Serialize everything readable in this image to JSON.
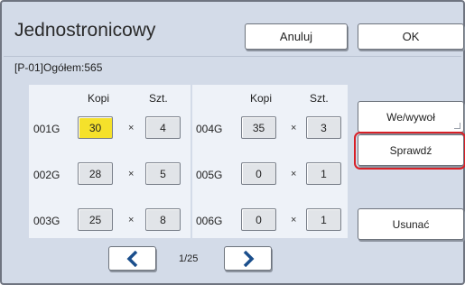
{
  "title": "Jednostronicowy",
  "buttons": {
    "cancel": "Anuluj",
    "ok": "OK",
    "import_export": "We/wywoł",
    "check": "Sprawdź",
    "delete": "Usunać"
  },
  "total_label": "[P-01]Ogółem:565",
  "headers": {
    "copies": "Kopi",
    "sets": "Szt."
  },
  "times_symbol": "×",
  "rows": [
    {
      "code": "001G",
      "copies": "30",
      "sets": "4",
      "selected": true
    },
    {
      "code": "002G",
      "copies": "28",
      "sets": "5"
    },
    {
      "code": "003G",
      "copies": "25",
      "sets": "8"
    },
    {
      "code": "004G",
      "copies": "35",
      "sets": "3"
    },
    {
      "code": "005G",
      "copies": "0",
      "sets": "1"
    },
    {
      "code": "006G",
      "copies": "0",
      "sets": "1"
    }
  ],
  "pagination": {
    "page_label": "1/25"
  },
  "colors": {
    "background": "#d3dbe8",
    "panel": "#eef2f8",
    "selected_cell": "#f5e12b",
    "highlight": "#d82027",
    "arrow": "#1a4e8c"
  },
  "icons": {
    "prev": "chevron-left-icon",
    "next": "chevron-right-icon"
  }
}
